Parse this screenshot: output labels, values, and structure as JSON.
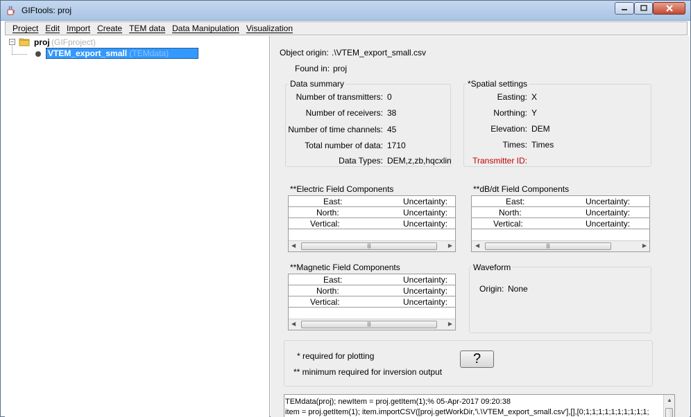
{
  "window": {
    "title": "GIFtools: proj",
    "app_icon": "java-cup-icon"
  },
  "menubar": {
    "items": [
      "Project",
      "Edit",
      "Import",
      "Create",
      "TEM data",
      "Data Manipulation",
      "Visualization"
    ]
  },
  "tree": {
    "root": {
      "label": "proj",
      "type": "(GIFproject)",
      "icon": "folder-icon",
      "expanded": true
    },
    "children": [
      {
        "label": "VTEM_export_small",
        "type": "(TEMdata)",
        "selected": true
      }
    ]
  },
  "details": {
    "object_origin_label": "Object origin:",
    "object_origin_value": ".\\VTEM_export_small.csv",
    "found_in_label": "Found in:",
    "found_in_value": "proj",
    "data_summary": {
      "title": "Data summary",
      "rows": [
        {
          "label": "Number of transmitters:",
          "value": "0"
        },
        {
          "label": "Number of receivers:",
          "value": "38"
        },
        {
          "label": "Number of time channels:",
          "value": "45"
        },
        {
          "label": "Total number of data:",
          "value": "1710"
        },
        {
          "label": "Data Types:",
          "value": "DEM,z,zb,hqcxlin"
        }
      ]
    },
    "spatial_settings": {
      "title": "*Spatial settings",
      "rows": [
        {
          "label": "Easting:",
          "value": "X"
        },
        {
          "label": "Northing:",
          "value": "Y"
        },
        {
          "label": "Elevation:",
          "value": "DEM"
        },
        {
          "label": "Times:",
          "value": "Times"
        },
        {
          "label": "Transmitter ID:",
          "value": "",
          "color": "#c00000"
        }
      ]
    },
    "electric": {
      "title": "**Electric Field Components",
      "rows": [
        {
          "component": "East:",
          "uncertainty": "Uncertainty:"
        },
        {
          "component": "North:",
          "uncertainty": "Uncertainty:"
        },
        {
          "component": "Vertical:",
          "uncertainty": "Uncertainty:"
        }
      ]
    },
    "dbdt": {
      "title": "**dB/dt Field Components",
      "rows": [
        {
          "component": "East:",
          "uncertainty": "Uncertainty:"
        },
        {
          "component": "North:",
          "uncertainty": "Uncertainty:"
        },
        {
          "component": "Vertical:",
          "uncertainty": "Uncertainty:"
        }
      ]
    },
    "magnetic": {
      "title": "**Magnetic Field Components",
      "rows": [
        {
          "component": "East:",
          "uncertainty": "Uncertainty:"
        },
        {
          "component": "North:",
          "uncertainty": "Uncertainty:"
        },
        {
          "component": "Vertical:",
          "uncertainty": "Uncertainty:"
        }
      ]
    },
    "waveform": {
      "title": "Waveform",
      "origin_label": "Origin:",
      "origin_value": "None"
    },
    "notes": {
      "required_plotting": "* required for plotting",
      "required_inversion": "** minimum required for inversion output",
      "help_button": "?"
    },
    "console": {
      "lines": [
        "TEMdata(proj); newItem = proj.getItem(1);% 05-Apr-2017 09:20:38",
        "item = proj.getItem(1); item.importCSV([proj.getWorkDir,'\\.\\VTEM_export_small.csv'],[],[0;1;1;1;1;1;1;1;1;1;1;"
      ]
    }
  },
  "colors": {
    "selection": "#3399ff",
    "panel_bg": "#eeeeee",
    "warning_text": "#c00000"
  }
}
